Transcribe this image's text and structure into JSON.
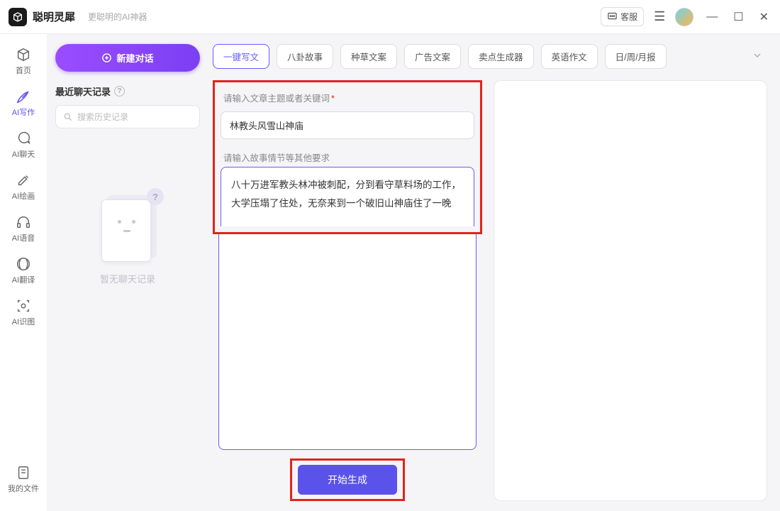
{
  "header": {
    "app_name": "聪明灵犀",
    "tagline": "更聪明的AI神器",
    "support_label": "客服"
  },
  "sidebar": {
    "items": [
      {
        "label": "首页"
      },
      {
        "label": "AI写作"
      },
      {
        "label": "AI聊天"
      },
      {
        "label": "AI绘画"
      },
      {
        "label": "AI语音"
      },
      {
        "label": "AI翻译"
      },
      {
        "label": "AI识图"
      }
    ],
    "bottom": {
      "label": "我的文件"
    }
  },
  "left_panel": {
    "new_chat_label": "新建对话",
    "recent_title": "最近聊天记录",
    "search_placeholder": "搜索历史记录",
    "empty_text": "暂无聊天记录"
  },
  "tabs": [
    {
      "label": "一键写文"
    },
    {
      "label": "八卦故事"
    },
    {
      "label": "种草文案"
    },
    {
      "label": "广告文案"
    },
    {
      "label": "卖点生成器"
    },
    {
      "label": "英语作文"
    },
    {
      "label": "日/周/月报"
    }
  ],
  "form": {
    "topic_label": "请输入文章主题或者关键词",
    "topic_value": "林教头风雪山神庙",
    "detail_label": "请输入故事情节等其他要求",
    "detail_value": "八十万进军教头林冲被刺配，分到看守草料场的工作，大学压塌了住处，无奈来到一个破旧山神庙住了一晚",
    "generate_label": "开始生成"
  }
}
